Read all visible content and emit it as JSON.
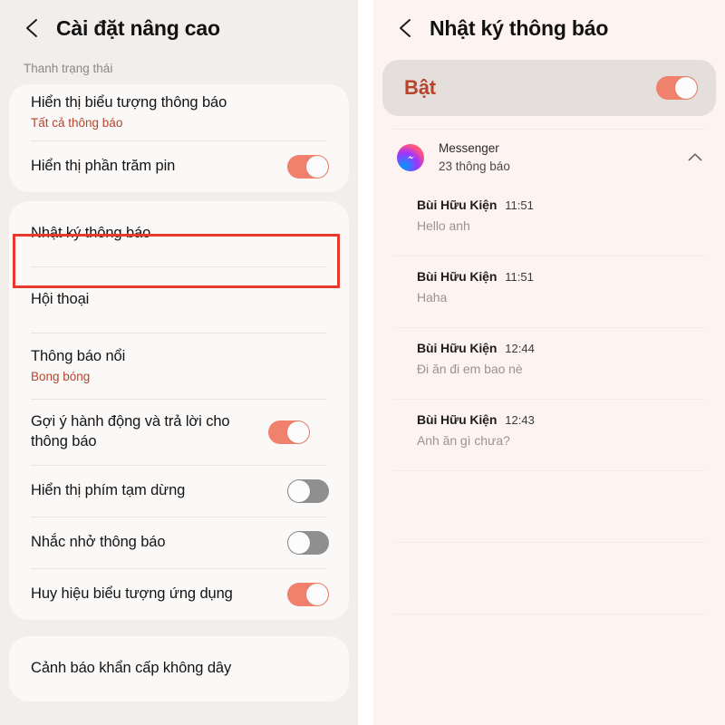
{
  "left_panel": {
    "back_icon": "back-chevron-icon",
    "title": "Cài đặt nâng cao",
    "section_label": "Thanh trạng thái",
    "items": [
      {
        "title": "Hiển thị biểu tượng thông báo",
        "subtitle": "Tất cả thông báo",
        "toggle": null
      },
      {
        "title": "Hiển thị phần trăm pin",
        "subtitle": null,
        "toggle": "on"
      },
      {
        "title": "Nhật ký thông báo",
        "subtitle": null,
        "toggle": null
      },
      {
        "title": "Hội thoại",
        "subtitle": null,
        "toggle": null
      },
      {
        "title": "Thông báo nổi",
        "subtitle": "Bong bóng",
        "toggle": null
      },
      {
        "title": "Gợi ý hành động và trả lời cho thông báo",
        "subtitle": null,
        "toggle": "on"
      },
      {
        "title": "Hiển thị phím tạm dừng",
        "subtitle": null,
        "toggle": "off"
      },
      {
        "title": "Nhắc nhở thông báo",
        "subtitle": null,
        "toggle": "off"
      },
      {
        "title": "Huy hiệu biểu tượng ứng dụng",
        "subtitle": null,
        "toggle": "on"
      }
    ],
    "footer_item": {
      "title": "Cảnh báo khẩn cấp không dây"
    }
  },
  "right_panel": {
    "back_icon": "back-chevron-icon",
    "title": "Nhật ký thông báo",
    "master_toggle": {
      "label": "Bật",
      "state": "on"
    },
    "app_group": {
      "icon": "messenger-icon",
      "name": "Messenger",
      "count_text": "23 thông báo",
      "collapse_icon": "chevron-up-icon"
    },
    "notifications": [
      {
        "sender": "Bùi Hữu Kiện",
        "time": "11:51",
        "message": "Hello anh"
      },
      {
        "sender": "Bùi Hữu Kiện",
        "time": "11:51",
        "message": "Haha"
      },
      {
        "sender": "Bùi Hữu Kiện",
        "time": "12:44",
        "message": "Đi ăn đi em bao nè"
      },
      {
        "sender": "Bùi Hữu Kiện",
        "time": "12:43",
        "message": "Anh ăn gì chưa?"
      }
    ],
    "redacted_notification_count": 3
  },
  "annotations": {
    "color": "#e8392b",
    "left_box_target": "Nhật ký thông báo",
    "right_box_target": "notification-list"
  },
  "colors": {
    "toggle_on": "#f0826d",
    "toggle_off": "#8f8f8f",
    "accent_text": "#b8432b",
    "left_bg": "#f2eeec",
    "right_bg": "#fdf3f1"
  }
}
